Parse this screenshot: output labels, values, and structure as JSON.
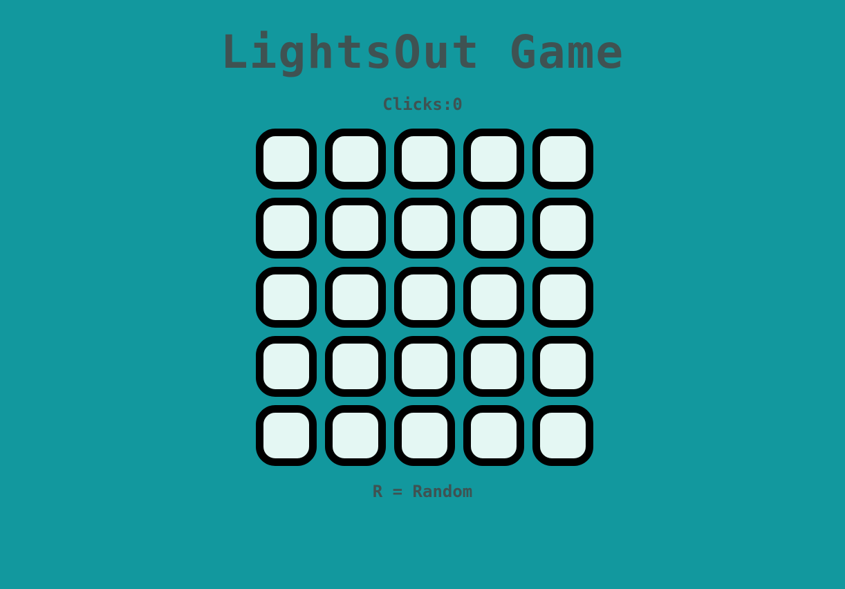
{
  "title": "LightsOut Game",
  "clicks": {
    "label": "Clicks:",
    "value": "0"
  },
  "board": {
    "rows": 5,
    "cols": 5,
    "cells": [
      [
        "on",
        "on",
        "on",
        "on",
        "on"
      ],
      [
        "on",
        "on",
        "on",
        "on",
        "on"
      ],
      [
        "on",
        "on",
        "on",
        "on",
        "on"
      ],
      [
        "on",
        "on",
        "on",
        "on",
        "on"
      ],
      [
        "on",
        "on",
        "on",
        "on",
        "on"
      ]
    ]
  },
  "hint": "R = Random",
  "colors": {
    "background": "#12989e",
    "text": "#3f5252",
    "cell_on": "#e4f7f3",
    "cell_border": "#000000"
  }
}
